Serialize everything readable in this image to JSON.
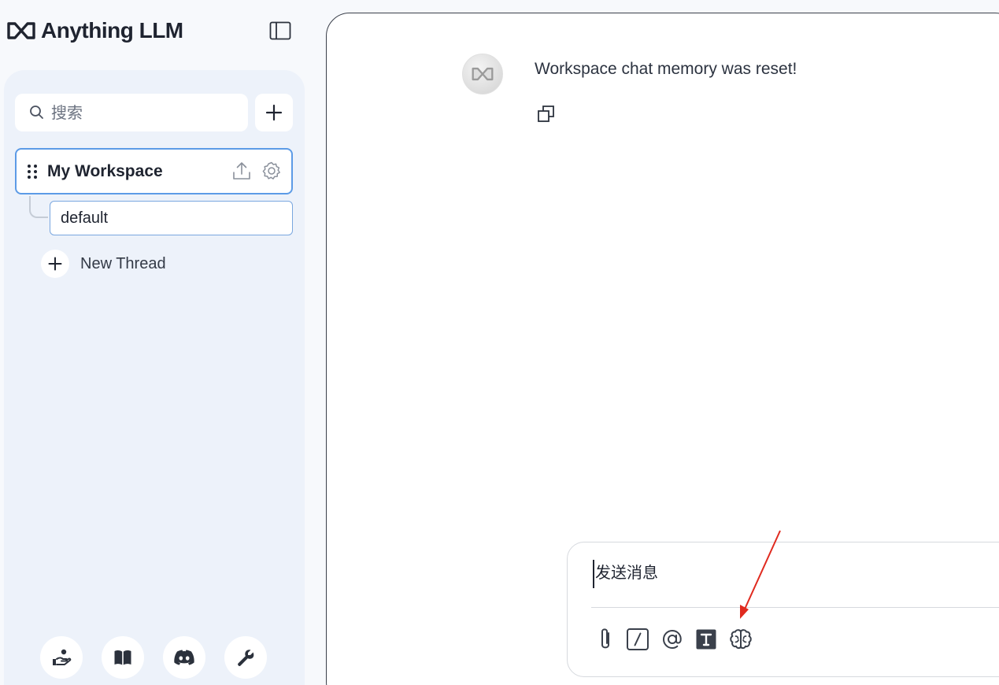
{
  "app": {
    "brand": "Anything LLM"
  },
  "sidebar": {
    "search": {
      "placeholder": "搜索"
    },
    "workspaces": [
      {
        "name": "My Workspace",
        "threads": [
          {
            "name": "default"
          }
        ]
      }
    ],
    "new_thread_label": "New Thread",
    "footer_icons": [
      "community-hand-icon",
      "docs-book-icon",
      "discord-icon",
      "settings-wrench-icon"
    ]
  },
  "chat": {
    "messages": [
      {
        "role": "assistant",
        "text": "Workspace chat memory was reset!"
      }
    ]
  },
  "composer": {
    "placeholder": "发送消息",
    "tools": [
      "attach-icon",
      "slash-command-icon",
      "mention-icon",
      "text-size-icon",
      "brain-icon"
    ]
  },
  "colors": {
    "sidebar_bg": "#edf2fa",
    "accent_border": "#5c9be6",
    "annotation_arrow": "#e02a1f"
  }
}
